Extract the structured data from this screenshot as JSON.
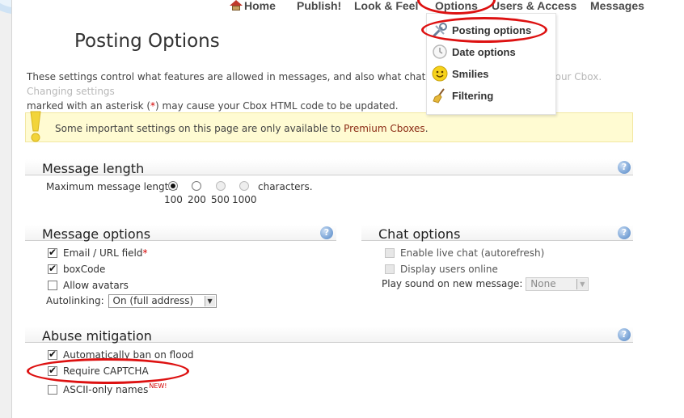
{
  "nav": {
    "items": [
      "Home",
      "Publish!",
      "Look & Feel",
      "Options",
      "Users & Access",
      "Messages"
    ]
  },
  "options_menu": {
    "items": [
      {
        "label": "Posting options",
        "icon": "wrench-icon"
      },
      {
        "label": "Date options",
        "icon": "clock-icon"
      },
      {
        "label": "Smilies",
        "icon": "smiley-icon"
      },
      {
        "label": "Filtering",
        "icon": "broom-icon"
      }
    ]
  },
  "page": {
    "title": "Posting Options",
    "intro_part1": "These settings control what features are allowed in messages, and also what chat features a",
    "intro_hidden": "re available in your Cbox. C",
    "intro_part2": "hanging settings",
    "intro_part3": "marked with an asterisk (",
    "intro_star": "*",
    "intro_part4": ") may cause your Cbox HTML code to be updated."
  },
  "notice": {
    "text": "Some important settings on this page are only available to ",
    "link": "Premium Cboxes",
    "suffix": "."
  },
  "message_length": {
    "title": "Message length",
    "label": "Maximum message length:",
    "suffix": "characters.",
    "options": [
      "100",
      "200",
      "500",
      "1000"
    ],
    "selected": "100"
  },
  "message_options": {
    "title": "Message options",
    "email_label": "Email / URL field",
    "email_star": "*",
    "boxcode_label": "boxCode",
    "avatars_label": "Allow avatars",
    "autolinking_label": "Autolinking:",
    "autolinking_value": "On (full address)"
  },
  "chat_options": {
    "title": "Chat options",
    "live_chat_label": "Enable live chat (autorefresh)",
    "users_online_label": "Display users online",
    "sound_label": "Play sound on new message:",
    "sound_value": "None"
  },
  "abuse": {
    "title": "Abuse mitigation",
    "autoban_label": "Automatically ban on flood",
    "captcha_label": "Require CAPTCHA",
    "ascii_label": "ASCII-only names",
    "new_badge": "NEW!"
  },
  "help_symbol": "?",
  "colors": {
    "annotation": "#dd1111",
    "notice_bg": "#fffbd2",
    "link": "#8b2a14",
    "help_blue": "#7ea7d8"
  }
}
